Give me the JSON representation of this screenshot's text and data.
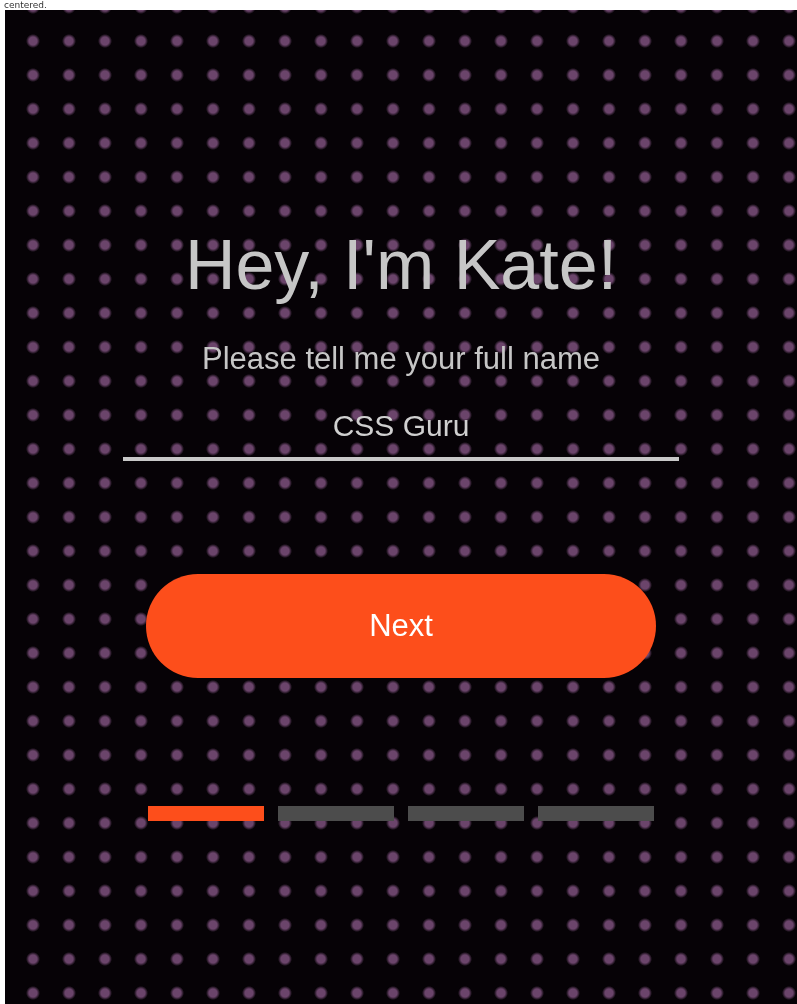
{
  "caption": "centered.",
  "heading": "Hey, I'm Kate!",
  "prompt": "Please tell me your full name",
  "name_field": {
    "value": "CSS Guru"
  },
  "button": {
    "label": "Next"
  },
  "steps": [
    {
      "selected": true
    },
    {
      "selected": false
    },
    {
      "selected": false
    },
    {
      "selected": false
    }
  ]
}
